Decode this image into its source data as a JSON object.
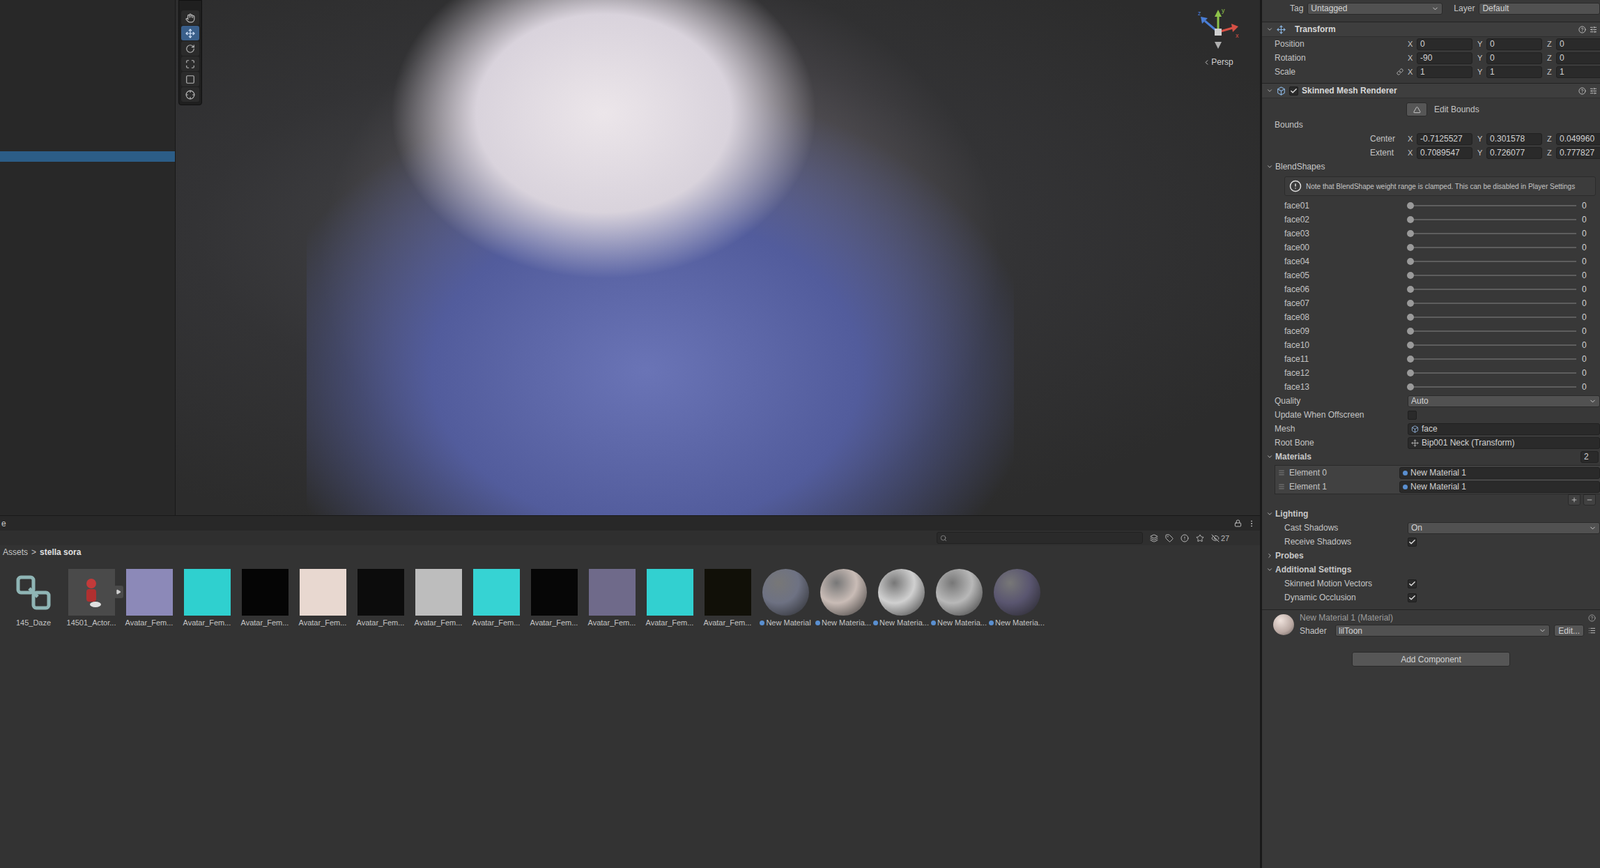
{
  "hierarchy": {
    "rows": [
      {
        "selected": false
      },
      {
        "selected": false
      },
      {
        "selected": false
      },
      {
        "selected": false
      },
      {
        "selected": false
      },
      {
        "selected": false
      },
      {
        "selected": false
      },
      {
        "selected": false
      },
      {
        "selected": false
      },
      {
        "selected": false
      },
      {
        "selected": true
      }
    ]
  },
  "scene": {
    "tools": [
      {
        "kind": "hand",
        "selected": false
      },
      {
        "kind": "move",
        "selected": true
      },
      {
        "kind": "rotate",
        "selected": false
      },
      {
        "kind": "scale",
        "selected": false
      },
      {
        "kind": "rect",
        "selected": false
      },
      {
        "kind": "transform",
        "selected": false
      }
    ],
    "gizmo_axes": [
      "z",
      "y",
      "x"
    ],
    "view": "Persp"
  },
  "project": {
    "tab": "e",
    "breadcrumb": [
      "Assets",
      "stella sora"
    ],
    "separator": ">",
    "hidden_count": "27",
    "assets": [
      {
        "label": "145_Daze",
        "kind": "prefab",
        "color": "#8fb5b5"
      },
      {
        "label": "14501_Actor...",
        "kind": "model",
        "color": "#4a4a4a"
      },
      {
        "label": "Avatar_Fem...",
        "kind": "texture",
        "color": "#8c89b8"
      },
      {
        "label": "Avatar_Fem...",
        "kind": "texture",
        "color": "#2fd0cf"
      },
      {
        "label": "Avatar_Fem...",
        "kind": "texture",
        "color": "#050505"
      },
      {
        "label": "Avatar_Fem...",
        "kind": "texture",
        "color": "#e8d8d0"
      },
      {
        "label": "Avatar_Fem...",
        "kind": "texture",
        "color": "#0c0c0c"
      },
      {
        "label": "Avatar_Fem...",
        "kind": "texture",
        "color": "#bdbdbd"
      },
      {
        "label": "Avatar_Fem...",
        "kind": "texture",
        "color": "#36d3d3"
      },
      {
        "label": "Avatar_Fem...",
        "kind": "texture",
        "color": "#060606"
      },
      {
        "label": "Avatar_Fem...",
        "kind": "texture",
        "color": "#6f6a8a"
      },
      {
        "label": "Avatar_Fem...",
        "kind": "texture",
        "color": "#32d0d0"
      },
      {
        "label": "Avatar_Fem...",
        "kind": "texture",
        "color": "#111008"
      },
      {
        "label": "New Material",
        "kind": "material",
        "color": "#6e7283"
      },
      {
        "label": "New Materia...",
        "kind": "material",
        "color": "#c9bcb6"
      },
      {
        "label": "New Materia...",
        "kind": "material",
        "color": "#d0d0d0"
      },
      {
        "label": "New Materia...",
        "kind": "material",
        "color": "#b8b8b8"
      },
      {
        "label": "New Materia...",
        "kind": "material",
        "color": "#5a5670"
      }
    ]
  },
  "inspector": {
    "tag": {
      "label": "Tag",
      "value": "Untagged"
    },
    "layer": {
      "label": "Layer",
      "value": "Default"
    },
    "transform": {
      "title": "Transform",
      "expanded": true,
      "rows": [
        {
          "label": "Position",
          "linked": false,
          "values": [
            {
              "axis": "X",
              "value": "0"
            },
            {
              "axis": "Y",
              "value": "0"
            },
            {
              "axis": "Z",
              "value": "0"
            }
          ]
        },
        {
          "label": "Rotation",
          "linked": false,
          "values": [
            {
              "axis": "X",
              "value": "-90"
            },
            {
              "axis": "Y",
              "value": "0"
            },
            {
              "axis": "Z",
              "value": "0"
            }
          ]
        },
        {
          "label": "Scale",
          "linked": true,
          "values": [
            {
              "axis": "X",
              "value": "1"
            },
            {
              "axis": "Y",
              "value": "1"
            },
            {
              "axis": "Z",
              "value": "1"
            }
          ]
        }
      ]
    },
    "renderer": {
      "title": "Skinned Mesh Renderer",
      "expanded": true,
      "enabled": true,
      "edit_bounds": "Edit Bounds",
      "bounds_label": "Bounds",
      "bounds": [
        {
          "label": "Center",
          "values": [
            {
              "axis": "X",
              "value": "-0.7125527"
            },
            {
              "axis": "Y",
              "value": "0.301578"
            },
            {
              "axis": "Z",
              "value": "0.049960"
            }
          ]
        },
        {
          "label": "Extent",
          "values": [
            {
              "axis": "X",
              "value": "0.7089547"
            },
            {
              "axis": "Y",
              "value": "0.726077"
            },
            {
              "axis": "Z",
              "value": "0.777827"
            }
          ]
        }
      ],
      "blendshapes": {
        "title": "BlendShapes",
        "expanded": true,
        "note": "Note that BlendShape weight range is clamped. This can be disabled in Player Settings",
        "items": [
          {
            "name": "face01",
            "level": 0,
            "value": "0"
          },
          {
            "name": "face02",
            "level": 0,
            "value": "0"
          },
          {
            "name": "face03",
            "level": 0,
            "value": "0"
          },
          {
            "name": "face00",
            "level": 0,
            "value": "0"
          },
          {
            "name": "face04",
            "level": 0,
            "value": "0"
          },
          {
            "name": "face05",
            "level": 0,
            "value": "0"
          },
          {
            "name": "face06",
            "level": 0,
            "value": "0"
          },
          {
            "name": "face07",
            "level": 0,
            "value": "0"
          },
          {
            "name": "face08",
            "level": 0,
            "value": "0"
          },
          {
            "name": "face09",
            "level": 0,
            "value": "0"
          },
          {
            "name": "face10",
            "level": 0,
            "value": "0"
          },
          {
            "name": "face11",
            "level": 0,
            "value": "0"
          },
          {
            "name": "face12",
            "level": 0,
            "value": "0"
          },
          {
            "name": "face13",
            "level": 0,
            "value": "0"
          }
        ]
      },
      "fields": [
        {
          "kind": "dropdown",
          "label": "Quality",
          "value": "Auto"
        },
        {
          "kind": "checkbox",
          "label": "Update When Offscreen",
          "checked": false
        },
        {
          "kind": "mesh",
          "label": "Mesh",
          "value": "face"
        },
        {
          "kind": "bone",
          "label": "Root Bone",
          "value": "Bip001 Neck (Transform)"
        }
      ],
      "materials": {
        "title": "Materials",
        "expanded": true,
        "count": "2",
        "elements": [
          {
            "label": "Element 0",
            "value": "New Material 1"
          },
          {
            "label": "Element 1",
            "value": "New Material 1"
          }
        ]
      },
      "sections": [
        {
          "title": "Lighting",
          "expanded": true,
          "fields": [
            {
              "kind": "dropdown",
              "label": "Cast Shadows",
              "value": "On"
            },
            {
              "kind": "checkbox",
              "label": "Receive Shadows",
              "checked": true
            }
          ]
        },
        {
          "title": "Probes",
          "expanded": false,
          "fields": []
        },
        {
          "title": "Additional Settings",
          "expanded": true,
          "fields": [
            {
              "kind": "checkbox",
              "label": "Skinned Motion Vectors",
              "checked": true
            },
            {
              "kind": "checkbox",
              "label": "Dynamic Occlusion",
              "checked": true
            }
          ]
        }
      ]
    },
    "material": {
      "title": "New Material 1 (Material)",
      "shader_label": "Shader",
      "shader": "lilToon",
      "edit": "Edit..."
    },
    "add_component": "Add Component"
  }
}
